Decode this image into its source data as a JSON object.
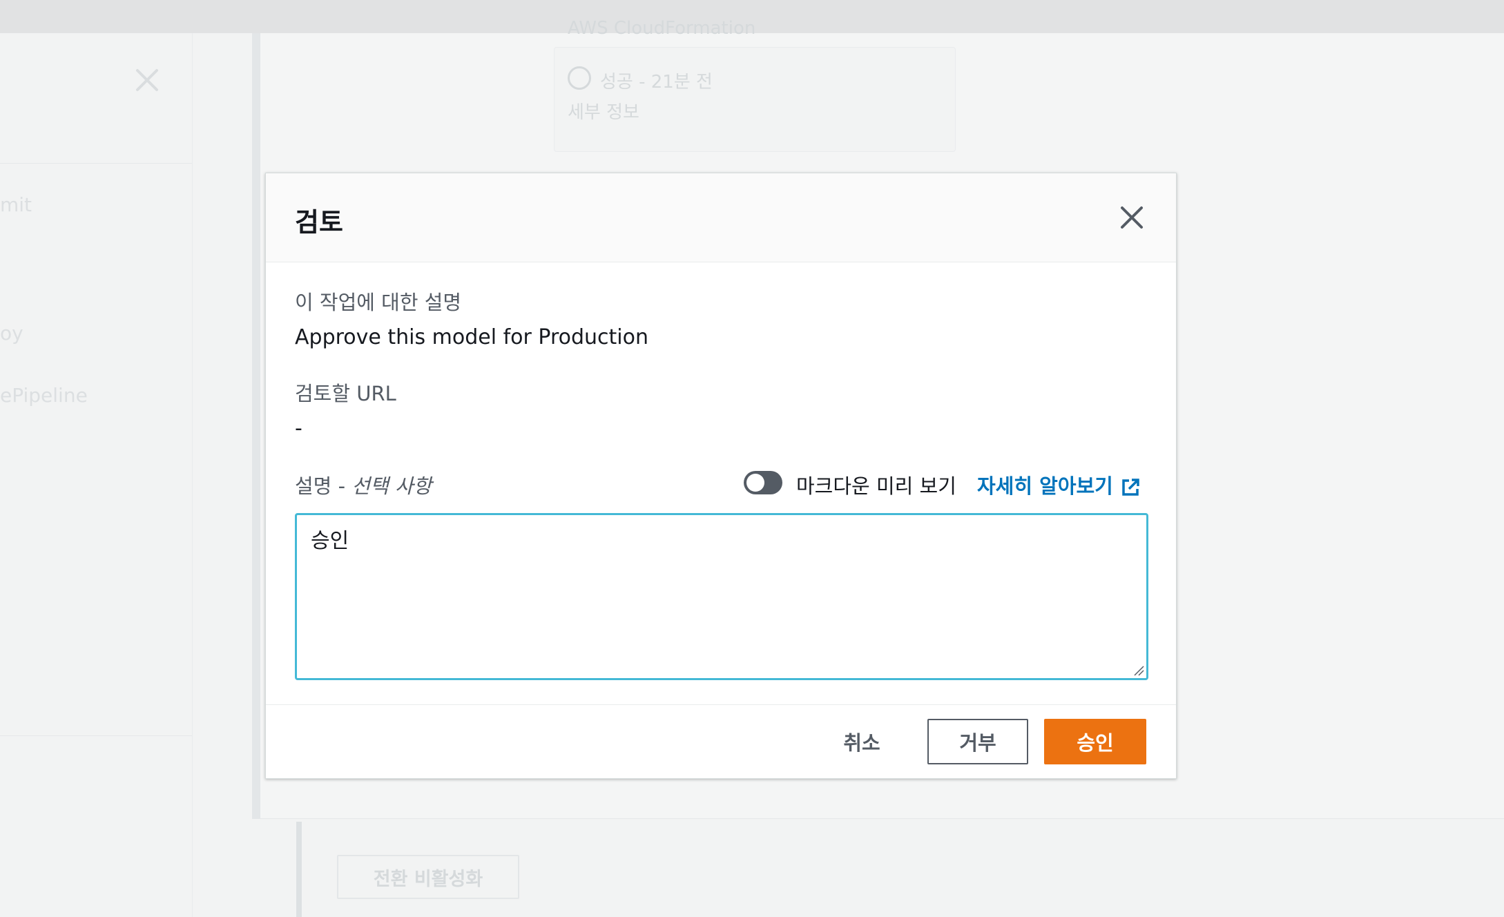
{
  "background": {
    "left_items": [
      "mit",
      "oy",
      "ePipeline"
    ],
    "card_link_text": "AWS CloudFormation",
    "status_text": "성공 - 21분 전",
    "details_link": "세부 정보",
    "disable_transition_button": "전환 비활성화"
  },
  "modal": {
    "title": "검토",
    "description_label": "이 작업에 대한 설명",
    "description_value": "Approve this model for Production",
    "url_label": "검토할 URL",
    "url_value": "-",
    "comment_label_main": "설명 - ",
    "comment_label_optional": "선택 사항",
    "markdown_preview_label": "마크다운 미리 보기",
    "markdown_preview_enabled": false,
    "learn_more_link": "자세히 알아보기",
    "comment_value": "승인",
    "cancel_button": "취소",
    "reject_button": "거부",
    "approve_button": "승인"
  },
  "colors": {
    "approve": "#ec7211",
    "link": "#0073bb",
    "focus_border": "#44b9d6"
  }
}
